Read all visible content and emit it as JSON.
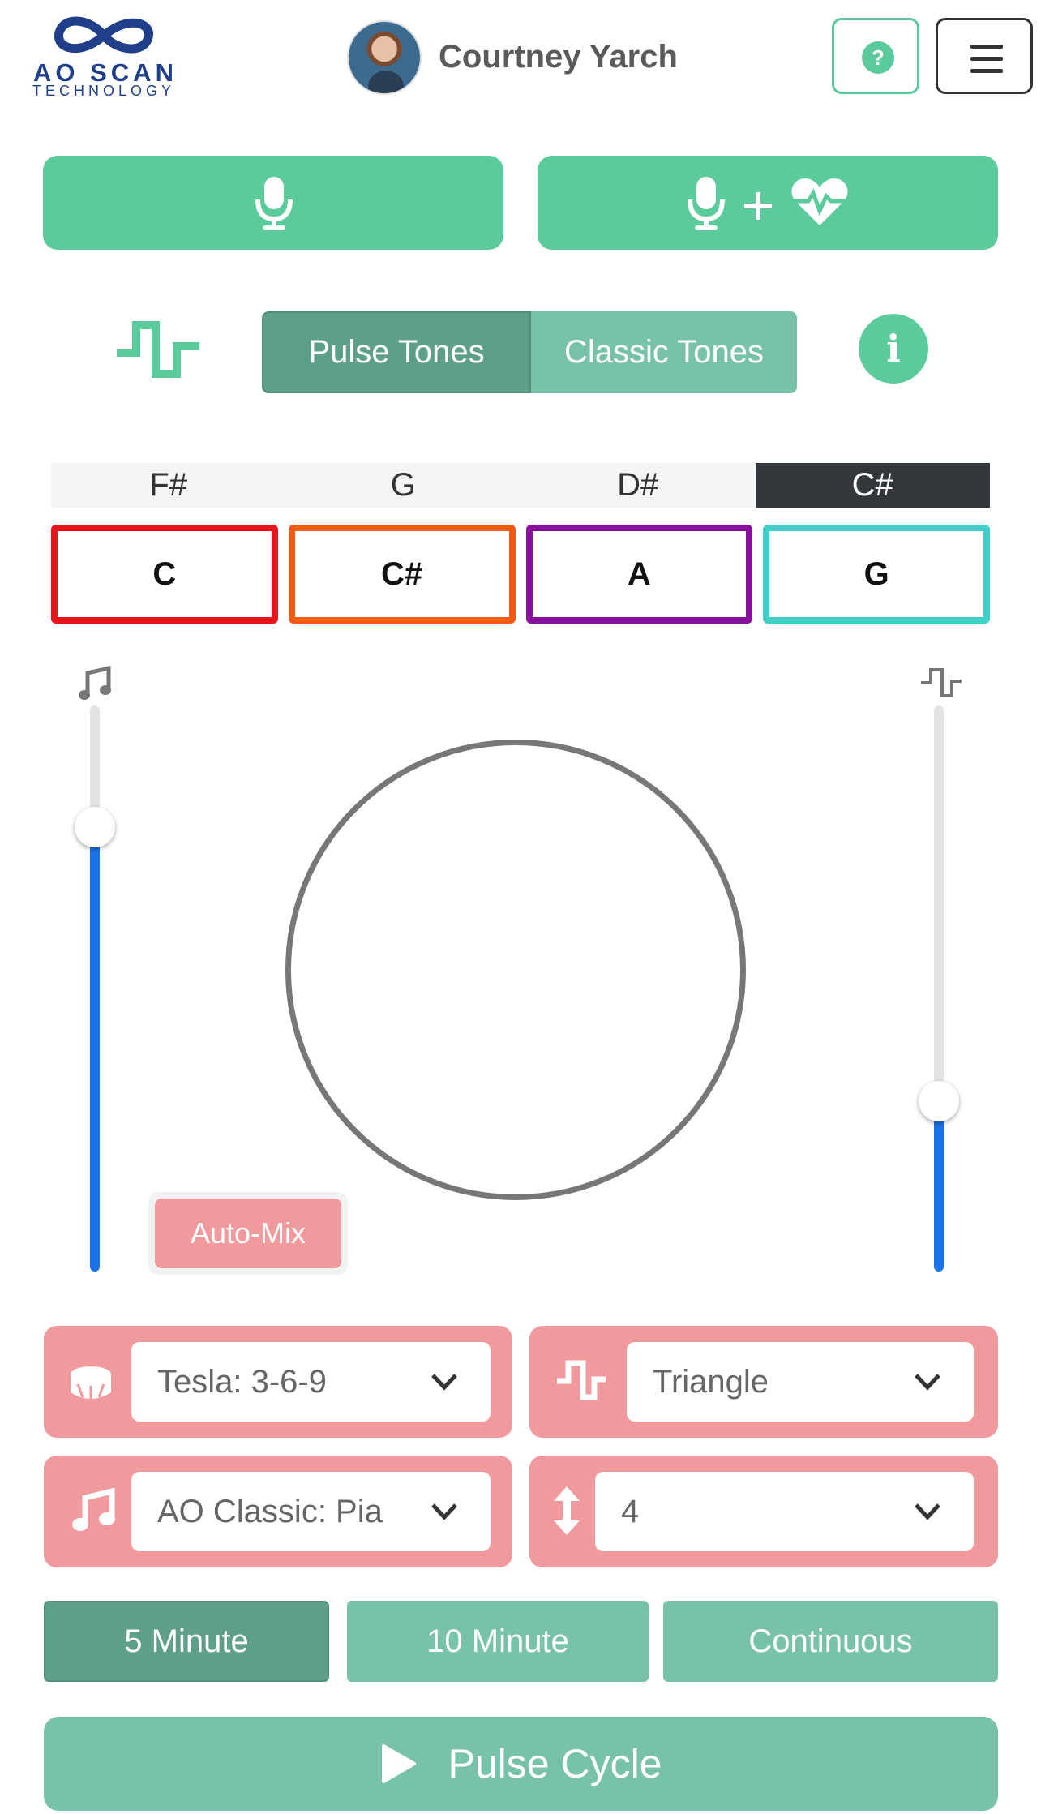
{
  "header": {
    "logo_text": "AO SCAN",
    "logo_subtext": "TECHNOLOGY",
    "user_name": "Courtney Yarch",
    "help_icon": "question-circle-icon",
    "menu_icon": "hamburger-menu-icon"
  },
  "record_buttons": {
    "voice_icon": "microphone-icon",
    "voice_heart_icons": [
      "microphone-icon",
      "plus-icon",
      "heart-pulse-icon"
    ]
  },
  "tone_mode": {
    "options": [
      "Pulse Tones",
      "Classic Tones"
    ],
    "selected": "Pulse Tones",
    "info_icon": "info-icon"
  },
  "keys": {
    "headers": [
      "F#",
      "G",
      "D#",
      "C#"
    ],
    "active_header": "C#",
    "boxes": [
      {
        "label": "C",
        "color": "#e8141a"
      },
      {
        "label": "C#",
        "color": "#f05a12"
      },
      {
        "label": "A",
        "color": "#8a0f9e"
      },
      {
        "label": "G",
        "color": "#40cfc8"
      }
    ]
  },
  "sliders": {
    "music_level": 0.8,
    "pulse_level": 0.3
  },
  "automix_label": "Auto-Mix",
  "dropdowns": {
    "rhythm": {
      "icon": "drum-icon",
      "value": "Tesla: 3-6-9"
    },
    "waveform": {
      "icon": "square-wave-icon",
      "value": "Triangle"
    },
    "instrument": {
      "icon": "music-note-icon",
      "value": "AO Classic: Pia"
    },
    "intensity": {
      "icon": "vertical-arrows-icon",
      "value": "4"
    }
  },
  "duration": {
    "options": [
      "5 Minute",
      "10 Minute",
      "Continuous"
    ],
    "selected": "5 Minute"
  },
  "play_button": {
    "icon": "play-icon",
    "label": "Pulse Cycle"
  },
  "colors": {
    "green": "#5ccb9c",
    "teal_dark": "#5e9f8a",
    "teal_light": "#79c2aa",
    "pink": "#f19a9e",
    "slider_blue": "#1a73e8"
  }
}
